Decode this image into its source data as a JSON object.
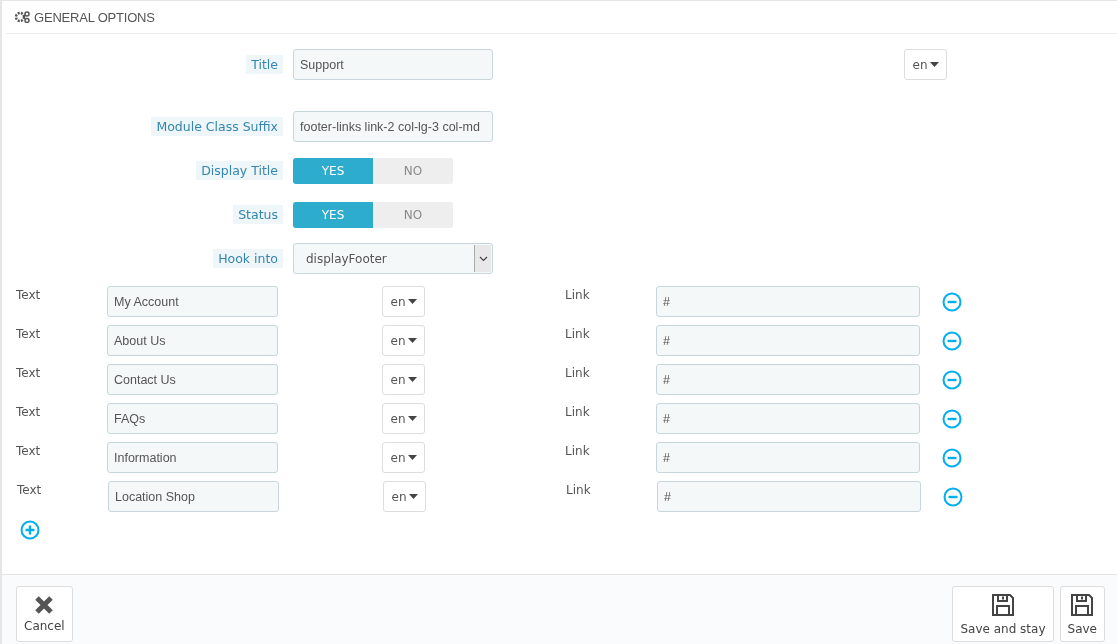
{
  "panel": {
    "title": "GENERAL OPTIONS"
  },
  "fields": [
    {
      "kind": "text",
      "label": "Title",
      "value": "Support",
      "lang": "en"
    },
    {
      "kind": "text",
      "label": "Module Class Suffix",
      "value": "footer-links link-2 col-lg-3 col-md"
    },
    {
      "kind": "switch",
      "label": "Display Title",
      "options": [
        {
          "label": "YES",
          "selected": true
        },
        {
          "label": "NO",
          "selected": false
        }
      ]
    },
    {
      "kind": "switch",
      "label": "Status",
      "options": [
        {
          "label": "YES",
          "selected": true
        },
        {
          "label": "NO",
          "selected": false
        }
      ]
    },
    {
      "kind": "select",
      "label": "Hook into",
      "value": "displayFooter"
    }
  ],
  "links": [
    {
      "text_label": "Text",
      "text": "My Account",
      "lang": "en",
      "link_label": "Link",
      "link": "#"
    },
    {
      "text_label": "Text",
      "text": "About Us",
      "lang": "en",
      "link_label": "Link",
      "link": "#"
    },
    {
      "text_label": "Text",
      "text": "Contact Us",
      "lang": "en",
      "link_label": "Link",
      "link": "#"
    },
    {
      "text_label": "Text",
      "text": "FAQs",
      "lang": "en",
      "link_label": "Link",
      "link": "#"
    },
    {
      "text_label": "Text",
      "text": "Information",
      "lang": "en",
      "link_label": "Link",
      "link": "#"
    },
    {
      "text_label": "Text",
      "text": "Location Shop",
      "lang": "en",
      "link_label": "Link",
      "link": "#"
    }
  ],
  "footer": {
    "cancel": "Cancel",
    "save_and_stay": "Save and stay",
    "save": "Save"
  }
}
